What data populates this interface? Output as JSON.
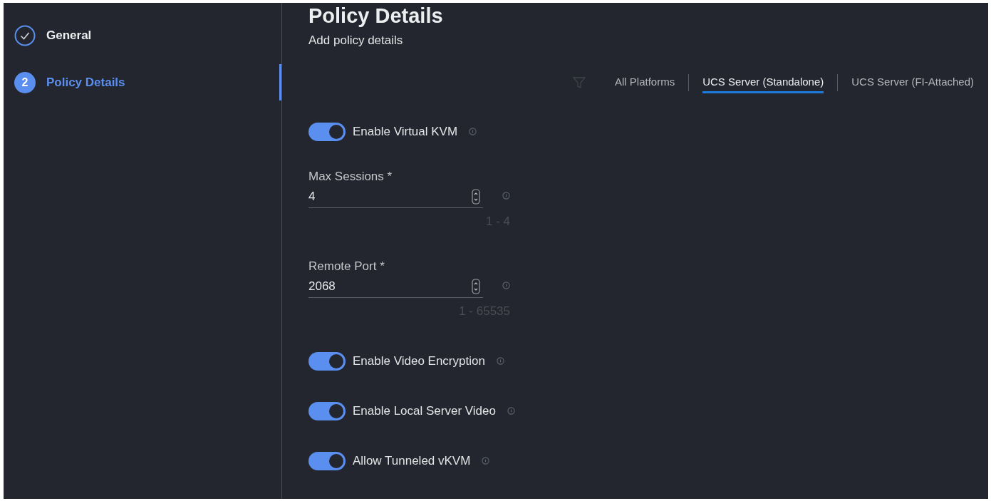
{
  "steps": [
    {
      "label": "General",
      "completed": true,
      "selected": false
    },
    {
      "number": "2",
      "label": "Policy Details",
      "completed": false,
      "selected": true
    }
  ],
  "header": {
    "title": "Policy Details",
    "subtitle": "Add policy details"
  },
  "platform_tabs": [
    {
      "label": "All Platforms",
      "selected": false
    },
    {
      "label": "UCS Server (Standalone)",
      "selected": true
    },
    {
      "label": "UCS Server (FI-Attached)",
      "selected": false
    }
  ],
  "fields": [
    {
      "kind": "toggle",
      "label": "Enable Virtual KVM",
      "on": true
    },
    {
      "kind": "number",
      "label": "Max Sessions *",
      "value": "4",
      "range": "1 - 4"
    },
    {
      "kind": "number",
      "label": "Remote Port *",
      "value": "2068",
      "range": "1 - 65535"
    },
    {
      "kind": "toggle",
      "label": "Enable Video Encryption",
      "on": true
    },
    {
      "kind": "toggle",
      "label": "Enable Local Server Video",
      "on": true
    },
    {
      "kind": "toggle",
      "label": "Allow Tunneled vKVM",
      "on": true
    }
  ]
}
